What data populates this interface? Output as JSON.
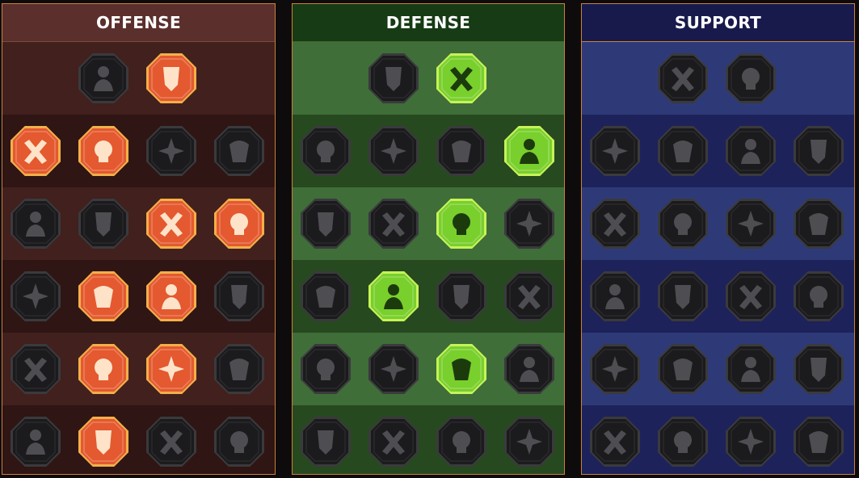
{
  "colors": {
    "offense_active_fill": "#e4592f",
    "offense_active_rim": "#f1b04a",
    "defense_active_fill": "#79cf2c",
    "defense_active_rim": "#c6f25a",
    "inactive_fill": "#1b1b1d",
    "inactive_rim": "#3a3a3d",
    "inactive_glyph": "#4e4e52"
  },
  "panels": [
    {
      "key": "offense",
      "title": "OFFENSE",
      "rows": [
        [
          {
            "icon": "crossed-swords-icon",
            "active": false
          },
          {
            "icon": "blade-slash-icon",
            "active": true
          }
        ],
        [
          {
            "icon": "horned-demon-icon",
            "active": true
          },
          {
            "icon": "piercing-lance-icon",
            "active": true
          },
          {
            "icon": "shield-break-icon",
            "active": false
          },
          {
            "icon": "cursed-heart-icon",
            "active": false
          }
        ],
        [
          {
            "icon": "arrow-pierced-warrior-icon",
            "active": false
          },
          {
            "icon": "fanged-maw-icon",
            "active": false
          },
          {
            "icon": "skull-slash-icon",
            "active": true
          },
          {
            "icon": "reaper-scythe-icon",
            "active": true
          }
        ],
        [
          {
            "icon": "bleeding-heart-dagger-icon",
            "active": false
          },
          {
            "icon": "fist-hammer-icon",
            "active": true
          },
          {
            "icon": "battle-axe-icon",
            "active": true
          },
          {
            "icon": "lightning-chain-icon",
            "active": false
          }
        ],
        [
          {
            "icon": "crossed-spears-icon",
            "active": false
          },
          {
            "icon": "triple-skull-icon",
            "active": true
          },
          {
            "icon": "sword-ring-icon",
            "active": true
          },
          {
            "icon": "shocked-giant-icon",
            "active": false
          }
        ],
        [
          {
            "icon": "sparkling-sword-icon",
            "active": false
          },
          {
            "icon": "flaming-helmet-icon",
            "active": true
          },
          {
            "icon": "horned-brute-icon",
            "active": false
          },
          {
            "icon": "spiked-helm-warrior-icon",
            "active": false
          }
        ]
      ]
    },
    {
      "key": "defense",
      "title": "DEFENSE",
      "rows": [
        [
          {
            "icon": "stone-wall-icon",
            "active": false
          },
          {
            "icon": "raised-fist-icon",
            "active": true
          }
        ],
        [
          {
            "icon": "pauldron-icon",
            "active": false
          },
          {
            "icon": "armored-heart-icon",
            "active": false
          },
          {
            "icon": "armored-torso-icon",
            "active": false
          },
          {
            "icon": "deflect-bolt-icon",
            "active": true
          }
        ],
        [
          {
            "icon": "archer-shield-icon",
            "active": false
          },
          {
            "icon": "knight-shield-icon",
            "active": false
          },
          {
            "icon": "skull-heart-icon",
            "active": true
          },
          {
            "icon": "hooded-figure-icon",
            "active": false
          }
        ],
        [
          {
            "icon": "crowd-rally-icon",
            "active": false
          },
          {
            "icon": "hourglass-skull-icon",
            "active": true
          },
          {
            "icon": "open-palm-icon",
            "active": false
          },
          {
            "icon": "bull-head-icon",
            "active": false
          }
        ],
        [
          {
            "icon": "dash-runner-icon",
            "active": false
          },
          {
            "icon": "claw-drops-icon",
            "active": false
          },
          {
            "icon": "radiant-skull-icon",
            "active": true
          },
          {
            "icon": "swift-strike-icon",
            "active": false
          }
        ],
        [
          {
            "icon": "spiky-beast-icon",
            "active": false
          },
          {
            "icon": "winged-shield-icon",
            "active": false
          },
          {
            "icon": "bearded-warrior-icon",
            "active": false
          },
          {
            "icon": "flexing-giant-icon",
            "active": false
          }
        ]
      ]
    },
    {
      "key": "support",
      "title": "SUPPORT",
      "rows": [
        [
          {
            "icon": "heart-plus-icon",
            "active": false
          },
          {
            "icon": "rope-binding-icon",
            "active": false
          }
        ],
        [
          {
            "icon": "praying-hands-icon",
            "active": false
          },
          {
            "icon": "arc-shield-icon",
            "active": false
          },
          {
            "icon": "flaming-skull-icon",
            "active": false
          },
          {
            "icon": "wind-dash-icon",
            "active": false
          }
        ],
        [
          {
            "icon": "sparkle-figure-icon",
            "active": false
          },
          {
            "icon": "lightning-shield-icon",
            "active": false
          },
          {
            "icon": "cracked-ground-icon",
            "active": false
          },
          {
            "icon": "twin-silhouette-icon",
            "active": false
          }
        ],
        [
          {
            "icon": "chained-heart-icon",
            "active": false
          },
          {
            "icon": "comet-icon",
            "active": false
          },
          {
            "icon": "open-book-icon",
            "active": false
          },
          {
            "icon": "glaring-eyes-icon",
            "active": false
          }
        ],
        [
          {
            "icon": "compass-star-icon",
            "active": false
          },
          {
            "icon": "boot-speed-icon",
            "active": false
          },
          {
            "icon": "all-seeing-eye-icon",
            "active": false
          },
          {
            "icon": "staggered-figure-icon",
            "active": false
          }
        ],
        [
          {
            "icon": "potion-flask-icon",
            "active": false
          },
          {
            "icon": "winged-skull-icon",
            "active": false
          },
          {
            "icon": "castle-fist-icon",
            "active": false
          },
          {
            "icon": "eagle-head-icon",
            "active": false
          }
        ]
      ]
    }
  ]
}
